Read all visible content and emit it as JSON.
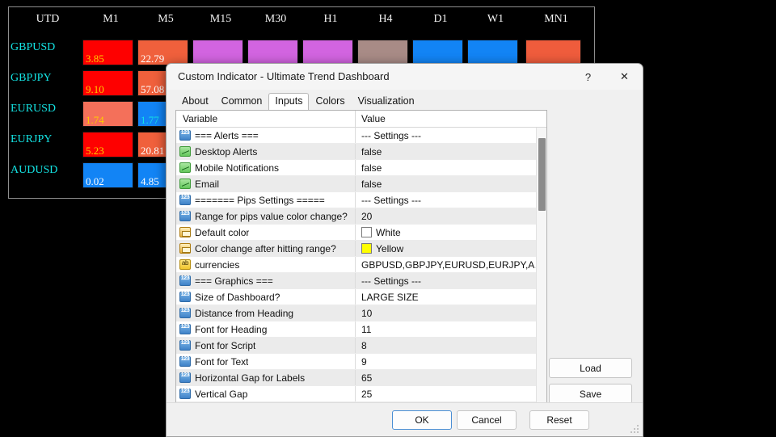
{
  "dashboard": {
    "timeframes": [
      "UTD",
      "M1",
      "M5",
      "M15",
      "M30",
      "H1",
      "H4",
      "D1",
      "W1",
      "MN1"
    ],
    "rows": [
      {
        "pair": "GBPUSD",
        "cells": [
          {
            "value": "3.85",
            "bg": "#fe0000",
            "fg": "#ffcc00"
          },
          {
            "value": "22.79",
            "bg": "#f0603c",
            "fg": "#ffffff"
          },
          {
            "value": "",
            "bg": "#d264e0",
            "fg": "#ffffff"
          },
          {
            "value": "",
            "bg": "#d264e0",
            "fg": "#ffffff"
          },
          {
            "value": "",
            "bg": "#d264e0",
            "fg": "#ffffff"
          },
          {
            "value": "",
            "bg": "#a88b86",
            "fg": "#ffffff"
          },
          {
            "value": "",
            "bg": "#1284f5",
            "fg": "#ffffff"
          },
          {
            "value": "",
            "bg": "#1284f5",
            "fg": "#ffffff"
          },
          {
            "value": "",
            "bg": "#ef5c3c",
            "fg": "#ffffff"
          }
        ]
      },
      {
        "pair": "GBPJPY",
        "cells": [
          {
            "value": "9.10",
            "bg": "#fe0000",
            "fg": "#ffcc00"
          },
          {
            "value": "57.08",
            "bg": "#f0603c",
            "fg": "#ffffff"
          }
        ]
      },
      {
        "pair": "EURUSD",
        "cells": [
          {
            "value": "1.74",
            "bg": "#f4705a",
            "fg": "#ffcc00"
          },
          {
            "value": "1.77",
            "bg": "#1284f5",
            "fg": "#14e3e3"
          }
        ]
      },
      {
        "pair": "EURJPY",
        "cells": [
          {
            "value": "5.23",
            "bg": "#fe0000",
            "fg": "#ffcc00"
          },
          {
            "value": "20.81",
            "bg": "#f0603c",
            "fg": "#ffffff"
          }
        ]
      },
      {
        "pair": "AUDUSD",
        "cells": [
          {
            "value": "0.02",
            "bg": "#1284f5",
            "fg": "#ffffff"
          },
          {
            "value": "4.85",
            "bg": "#1284f5",
            "fg": "#ffffff"
          }
        ]
      }
    ]
  },
  "dialog": {
    "title": "Custom Indicator - Ultimate Trend Dashboard",
    "help_label": "?",
    "close_label": "✕",
    "tabs": [
      {
        "label": "About",
        "active": false
      },
      {
        "label": "Common",
        "active": false
      },
      {
        "label": "Inputs",
        "active": true
      },
      {
        "label": "Colors",
        "active": false
      },
      {
        "label": "Visualization",
        "active": false
      }
    ],
    "table": {
      "columns": [
        "Variable",
        "Value"
      ],
      "rows": [
        {
          "icon": "int-icon",
          "variable": "=== Alerts ===",
          "value": "--- Settings ---"
        },
        {
          "icon": "bool-icon",
          "variable": "Desktop Alerts",
          "value": "false"
        },
        {
          "icon": "bool-icon",
          "variable": "Mobile Notifications",
          "value": "false"
        },
        {
          "icon": "bool-icon",
          "variable": "Email",
          "value": "false"
        },
        {
          "icon": "int-icon",
          "variable": "======= Pips Settings =====",
          "value": "--- Settings ---"
        },
        {
          "icon": "int-icon",
          "variable": "Range for pips value color change?",
          "value": "20"
        },
        {
          "icon": "color-icon",
          "variable": "Default color",
          "value": "White",
          "swatch": "#ffffff"
        },
        {
          "icon": "color-icon",
          "variable": "Color change after hitting range?",
          "value": "Yellow",
          "swatch": "#ffff00"
        },
        {
          "icon": "string-icon",
          "variable": "currencies",
          "value": "GBPUSD,GBPJPY,EURUSD,EURJPY,AU..."
        },
        {
          "icon": "int-icon",
          "variable": "=== Graphics ===",
          "value": "--- Settings ---"
        },
        {
          "icon": "int-icon",
          "variable": "Size of Dashboard?",
          "value": "LARGE SIZE"
        },
        {
          "icon": "int-icon",
          "variable": "Distance from Heading",
          "value": "10"
        },
        {
          "icon": "int-icon",
          "variable": "Font for Heading",
          "value": "11"
        },
        {
          "icon": "int-icon",
          "variable": "Font for Script",
          "value": "8"
        },
        {
          "icon": "int-icon",
          "variable": "Font for Text",
          "value": "9"
        },
        {
          "icon": "int-icon",
          "variable": "Horizontal Gap for Labels",
          "value": "65"
        },
        {
          "icon": "int-icon",
          "variable": "Vertical Gap",
          "value": "25"
        },
        {
          "icon": "color-icon",
          "variable": "",
          "value": ""
        }
      ]
    },
    "side_buttons": {
      "load_label": "Load",
      "save_label": "Save"
    },
    "footer_buttons": {
      "ok_label": "OK",
      "cancel_label": "Cancel",
      "reset_label": "Reset"
    }
  }
}
